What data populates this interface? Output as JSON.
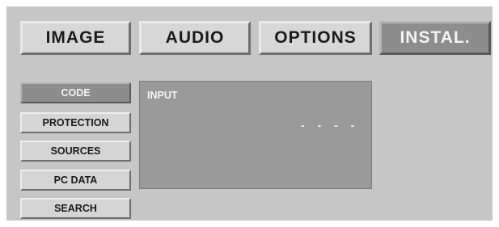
{
  "menu": {
    "tabs": [
      {
        "label": "IMAGE",
        "active": false
      },
      {
        "label": "AUDIO",
        "active": false
      },
      {
        "label": "OPTIONS",
        "active": false
      },
      {
        "label": "INSTAL.",
        "active": true
      }
    ]
  },
  "sidebar": {
    "items": [
      {
        "label": "CODE",
        "active": true
      },
      {
        "label": "PROTECTION",
        "active": false
      },
      {
        "label": "SOURCES",
        "active": false
      },
      {
        "label": "PC DATA",
        "active": false
      },
      {
        "label": "SEARCH",
        "active": false
      }
    ]
  },
  "content": {
    "label": "INPUT",
    "value": "- - - -"
  },
  "colors": {
    "panel_bg": "#c6c6c6",
    "button_bg": "#d7d7d7",
    "active_bg": "#8d8d8d",
    "content_bg": "#9a9a9a",
    "active_text": "#f4f4f4"
  }
}
